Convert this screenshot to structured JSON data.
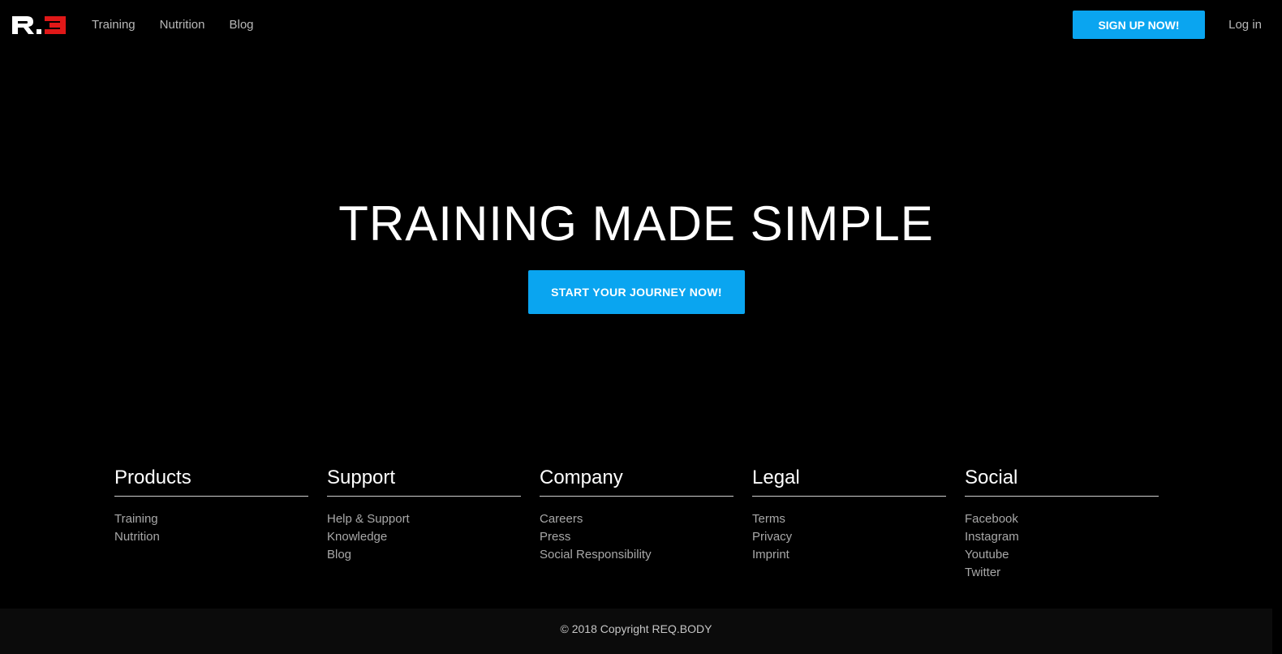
{
  "header": {
    "logo_text": "R.3",
    "nav": [
      "Training",
      "Nutrition",
      "Blog"
    ],
    "signup_label": "SIGN UP NOW!",
    "login_label": "Log in"
  },
  "hero": {
    "title": "TRAINING MADE SIMPLE",
    "cta_label": "START YOUR JOURNEY NOW!"
  },
  "footer": {
    "columns": [
      {
        "title": "Products",
        "links": [
          "Training",
          "Nutrition"
        ]
      },
      {
        "title": "Support",
        "links": [
          "Help & Support",
          "Knowledge",
          "Blog"
        ]
      },
      {
        "title": "Company",
        "links": [
          "Careers",
          "Press",
          "Social Responsibility"
        ]
      },
      {
        "title": "Legal",
        "links": [
          "Terms",
          "Privacy",
          "Imprint"
        ]
      },
      {
        "title": "Social",
        "links": [
          "Facebook",
          "Instagram",
          "Youtube",
          "Twitter"
        ]
      }
    ],
    "copyright": "© 2018 Copyright REQ.BODY"
  },
  "colors": {
    "accent": "#0aa5f0",
    "logo_red": "#e01818"
  }
}
